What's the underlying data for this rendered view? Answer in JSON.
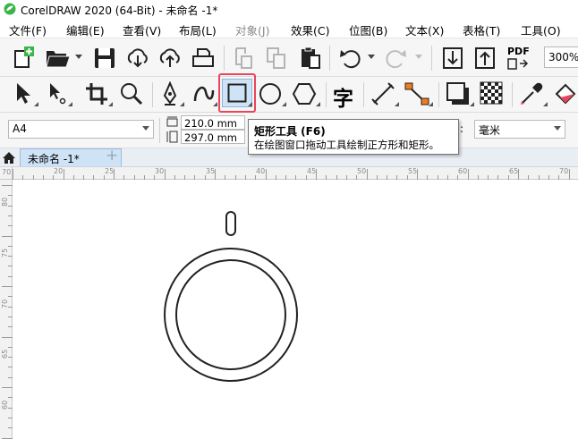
{
  "window": {
    "title": "CorelDRAW 2020 (64-Bit) - 未命名 -1*"
  },
  "menu": [
    "文件(F)",
    "编辑(E)",
    "查看(V)",
    "布局(L)",
    "对象(J)",
    "效果(C)",
    "位图(B)",
    "文本(X)",
    "表格(T)",
    "工具(O)"
  ],
  "toolbar": {
    "zoom": "300%",
    "pdf_label": "PDF"
  },
  "toolbox": {
    "text_tool_glyph": "字"
  },
  "propbar": {
    "page_size": "A4",
    "width": "210.0 mm",
    "height": "297.0 mm",
    "units": "毫米",
    "units_prefix": ":"
  },
  "tooltip": {
    "title": "矩形工具 (F6)",
    "description": "在绘图窗口拖动工具绘制正方形和矩形。"
  },
  "tabs": {
    "document": "未命名 -1*",
    "add": "+"
  },
  "ruler": {
    "horizontal": [
      "20",
      "25",
      "30",
      "35",
      "40",
      "45",
      "50",
      "55",
      "60",
      "65",
      "70"
    ],
    "vertical": [
      "80",
      "75",
      "70",
      "65",
      "60"
    ],
    "corner": "70"
  },
  "colors": {
    "accent": "#e8475a",
    "tab_active": "#cfe3f7",
    "logo_green": "#3bb54a"
  }
}
